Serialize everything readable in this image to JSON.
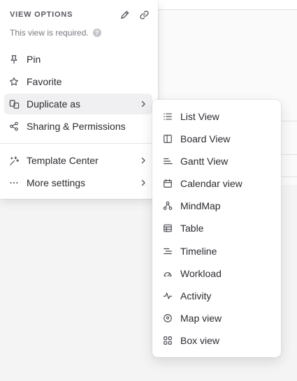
{
  "menu": {
    "title": "VIEW OPTIONS",
    "subtitle": "This view is required.",
    "items": [
      {
        "label": "Pin",
        "icon": "pin-icon"
      },
      {
        "label": "Favorite",
        "icon": "star-icon"
      },
      {
        "label": "Duplicate as",
        "icon": "duplicate-icon",
        "submenu": true,
        "active": true
      },
      {
        "label": "Sharing & Permissions",
        "icon": "share-icon"
      },
      {
        "label": "Template Center",
        "icon": "sparkles-icon",
        "submenu": true
      },
      {
        "label": "More settings",
        "icon": "more-icon",
        "submenu": true
      }
    ]
  },
  "submenu": {
    "items": [
      {
        "label": "List View",
        "icon": "list-icon"
      },
      {
        "label": "Board View",
        "icon": "board-icon"
      },
      {
        "label": "Gantt View",
        "icon": "gantt-icon"
      },
      {
        "label": "Calendar view",
        "icon": "calendar-icon"
      },
      {
        "label": "MindMap",
        "icon": "mindmap-icon"
      },
      {
        "label": "Table",
        "icon": "table-icon"
      },
      {
        "label": "Timeline",
        "icon": "timeline-icon"
      },
      {
        "label": "Workload",
        "icon": "workload-icon"
      },
      {
        "label": "Activity",
        "icon": "activity-icon"
      },
      {
        "label": "Map view",
        "icon": "map-pin-icon"
      },
      {
        "label": "Box view",
        "icon": "box-grid-icon"
      }
    ]
  }
}
